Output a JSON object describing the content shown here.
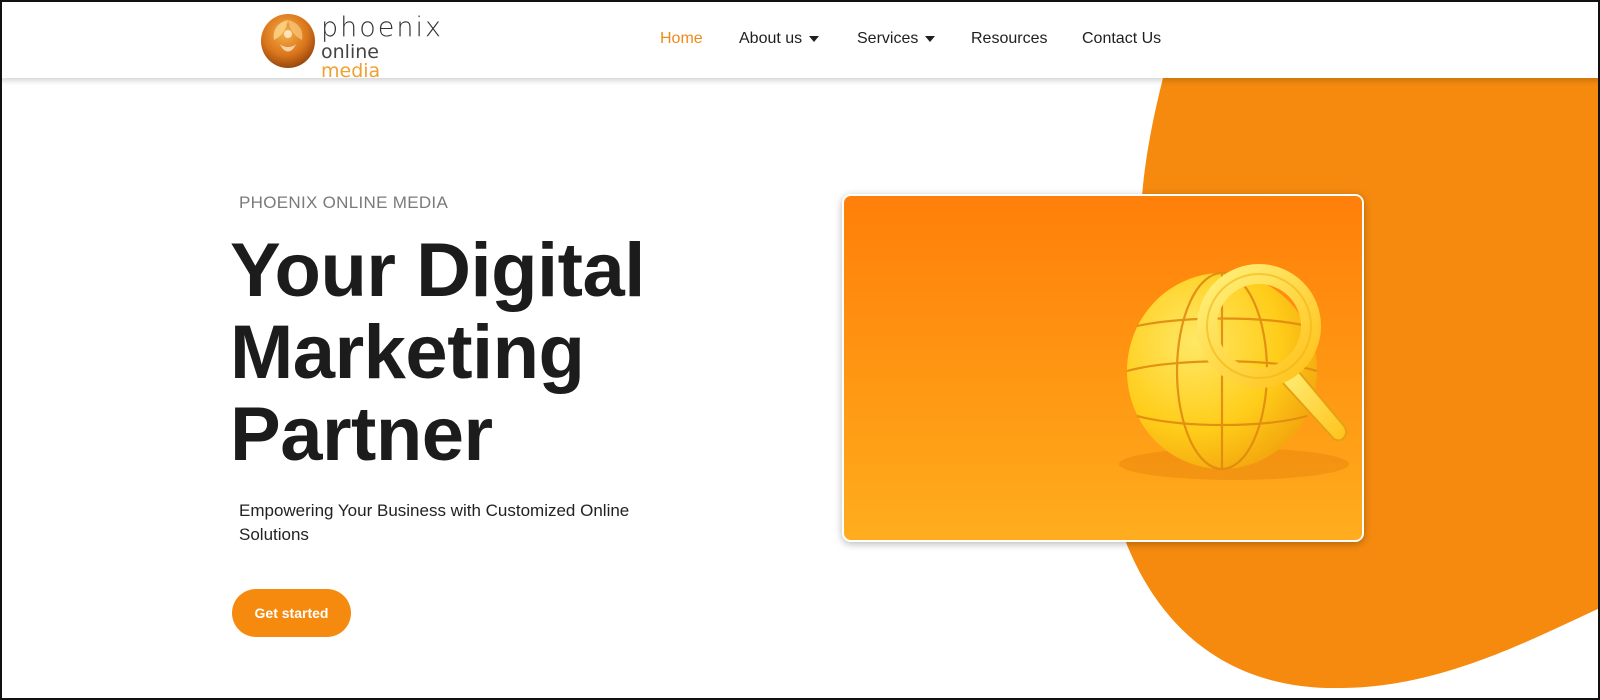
{
  "brand": {
    "logo_line1": "phoenix",
    "logo_line2_a": "online",
    "logo_line2_b": "media",
    "logo_icon": "phoenix-bird-icon"
  },
  "nav": {
    "items": [
      {
        "label": "Home",
        "active": true,
        "has_dropdown": false
      },
      {
        "label": "About us",
        "active": false,
        "has_dropdown": true
      },
      {
        "label": "Services",
        "active": false,
        "has_dropdown": true
      },
      {
        "label": "Resources",
        "active": false,
        "has_dropdown": false
      },
      {
        "label": "Contact Us",
        "active": false,
        "has_dropdown": false
      }
    ],
    "dropdown_icon": "caret-down-icon"
  },
  "hero": {
    "eyebrow": "PHOENIX ONLINE MEDIA",
    "headline_lines": [
      "Your Digital",
      "Marketing",
      "Partner"
    ],
    "subtext": "Empowering Your Business with Customized Online Solutions",
    "cta_label": "Get started",
    "image_subject": "globe-magnifier-icon"
  },
  "colors": {
    "accent": "#f58a0f",
    "nav_active": "#f0891a",
    "headline": "#1c1c1c",
    "eyebrow": "#7a7a7a"
  }
}
